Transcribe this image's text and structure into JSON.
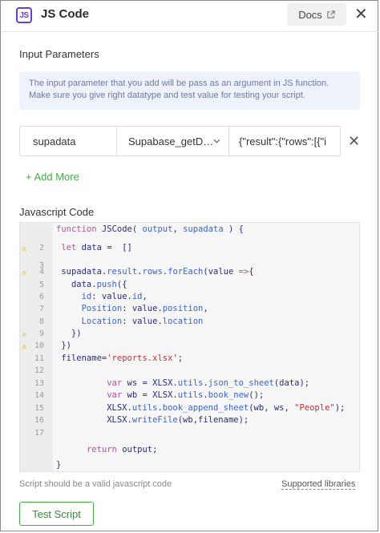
{
  "header": {
    "logo_text": "JS",
    "title": "JS Code",
    "docs_label": "Docs",
    "close": "✕"
  },
  "input_params": {
    "label": "Input Parameters",
    "info": "The input parameter that you add will be pass as an argument in JS function. Make sure you give right datatype and test value for testing your script.",
    "row": {
      "name": "supadata",
      "type": "Supabase_getD…",
      "value": "{\"result\":{\"rows\":[{\"i"
    },
    "remove": "✕",
    "add_more": "+ Add More"
  },
  "code": {
    "label": "Javascript Code",
    "lines": [
      {
        "n": "",
        "warn": false
      },
      {
        "n": "2",
        "warn": true
      },
      {
        "n": "3",
        "warn": false
      },
      {
        "n": "4",
        "warn": true
      },
      {
        "n": "5",
        "warn": false
      },
      {
        "n": "6",
        "warn": false
      },
      {
        "n": "7",
        "warn": false
      },
      {
        "n": "8",
        "warn": false
      },
      {
        "n": "9",
        "warn": true
      },
      {
        "n": "10",
        "warn": true
      },
      {
        "n": "11",
        "warn": false
      },
      {
        "n": "12",
        "warn": false
      },
      {
        "n": "13",
        "warn": false
      },
      {
        "n": "14",
        "warn": false
      },
      {
        "n": "15",
        "warn": false
      },
      {
        "n": "16",
        "warn": false
      },
      {
        "n": "17",
        "warn": false
      }
    ]
  },
  "footer": {
    "hint": "Script should be a valid javascript code",
    "supported": "Supported libraries",
    "test_button": "Test Script"
  }
}
